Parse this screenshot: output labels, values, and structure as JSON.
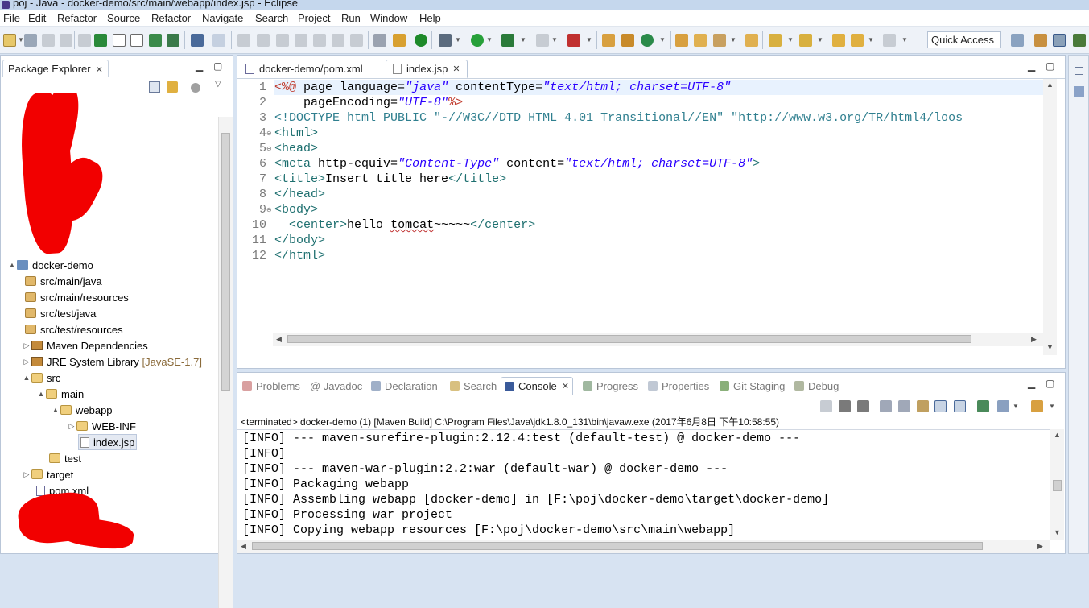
{
  "window": {
    "title": "poj - Java - docker-demo/src/main/webapp/index.jsp - Eclipse"
  },
  "menu": [
    "File",
    "Edit",
    "Refactor",
    "Source",
    "Refactor",
    "Navigate",
    "Search",
    "Project",
    "Run",
    "Window",
    "Help"
  ],
  "toolbar": {
    "quick_access": "Quick Access"
  },
  "package_explorer": {
    "title": "Package Explorer",
    "tree": [
      {
        "label": "docker-demo",
        "icon": "project-icon",
        "arrow": "▲"
      },
      {
        "label": "src/main/java",
        "icon": "package-folder-icon"
      },
      {
        "label": "src/main/resources",
        "icon": "package-folder-icon"
      },
      {
        "label": "src/test/java",
        "icon": "package-folder-icon"
      },
      {
        "label": "src/test/resources",
        "icon": "package-folder-icon"
      },
      {
        "label": "Maven Dependencies",
        "icon": "library-icon",
        "arrow": "▷"
      },
      {
        "label": "JRE System Library",
        "suffix": "[JavaSE-1.7]",
        "icon": "library-icon",
        "arrow": "▷"
      },
      {
        "label": "src",
        "icon": "folder-icon",
        "arrow": "▲"
      },
      {
        "label": "main",
        "icon": "folder-icon",
        "arrow": "▲"
      },
      {
        "label": "webapp",
        "icon": "folder-icon",
        "arrow": "▲"
      },
      {
        "label": "WEB-INF",
        "icon": "folder-icon",
        "arrow": "▷"
      },
      {
        "label": "index.jsp",
        "icon": "file-icon"
      },
      {
        "label": "test",
        "icon": "folder-icon"
      },
      {
        "label": "target",
        "icon": "folder-icon",
        "arrow": "▷"
      },
      {
        "label": "pom.xml",
        "icon": "xml-file-icon"
      }
    ]
  },
  "editor": {
    "tabs": [
      {
        "label": "docker-demo/pom.xml",
        "active": false
      },
      {
        "label": "index.jsp",
        "active": true
      }
    ],
    "line_numbers": [
      "1",
      "2",
      "3",
      "4",
      "5",
      "6",
      "7",
      "8",
      "9",
      "10",
      "11",
      "12"
    ],
    "lines": [
      "<%@ page language=\"java\" contentType=\"text/html; charset=UTF-8\"",
      "    pageEncoding=\"UTF-8\"%>",
      "<!DOCTYPE html PUBLIC \"-//W3C//DTD HTML 4.01 Transitional//EN\" \"http://www.w3.org/TR/html4/loos",
      "<html>",
      "<head>",
      "<meta http-equiv=\"Content-Type\" content=\"text/html; charset=UTF-8\">",
      "<title>Insert title here</title>",
      "</head>",
      "<body>",
      "  <center>hello tomcat~~~~~</center>",
      "</body>",
      "</html>"
    ]
  },
  "console": {
    "tabs": [
      "Problems",
      "@ Javadoc",
      "Declaration",
      "Search",
      "Console",
      "Progress",
      "Properties",
      "Git Staging",
      "Debug"
    ],
    "active_tab": "Console",
    "status": "<terminated> docker-demo (1) [Maven Build] C:\\Program Files\\Java\\jdk1.8.0_131\\bin\\javaw.exe (2017年6月8日 下午10:58:55)",
    "output": [
      "[INFO] --- maven-surefire-plugin:2.12.4:test (default-test) @ docker-demo ---",
      "[INFO]",
      "[INFO] --- maven-war-plugin:2.2:war (default-war) @ docker-demo ---",
      "[INFO] Packaging webapp",
      "[INFO] Assembling webapp [docker-demo] in [F:\\poj\\docker-demo\\target\\docker-demo]",
      "[INFO] Processing war project",
      "[INFO] Copying webapp resources [F:\\poj\\docker-demo\\src\\main\\webapp]"
    ]
  },
  "colors": {
    "jsp_tag": "#1d6f6f",
    "attribute": "#7f007f",
    "value": "#2a00ff",
    "directive": "#c0392b",
    "scribble": "#f20000"
  }
}
